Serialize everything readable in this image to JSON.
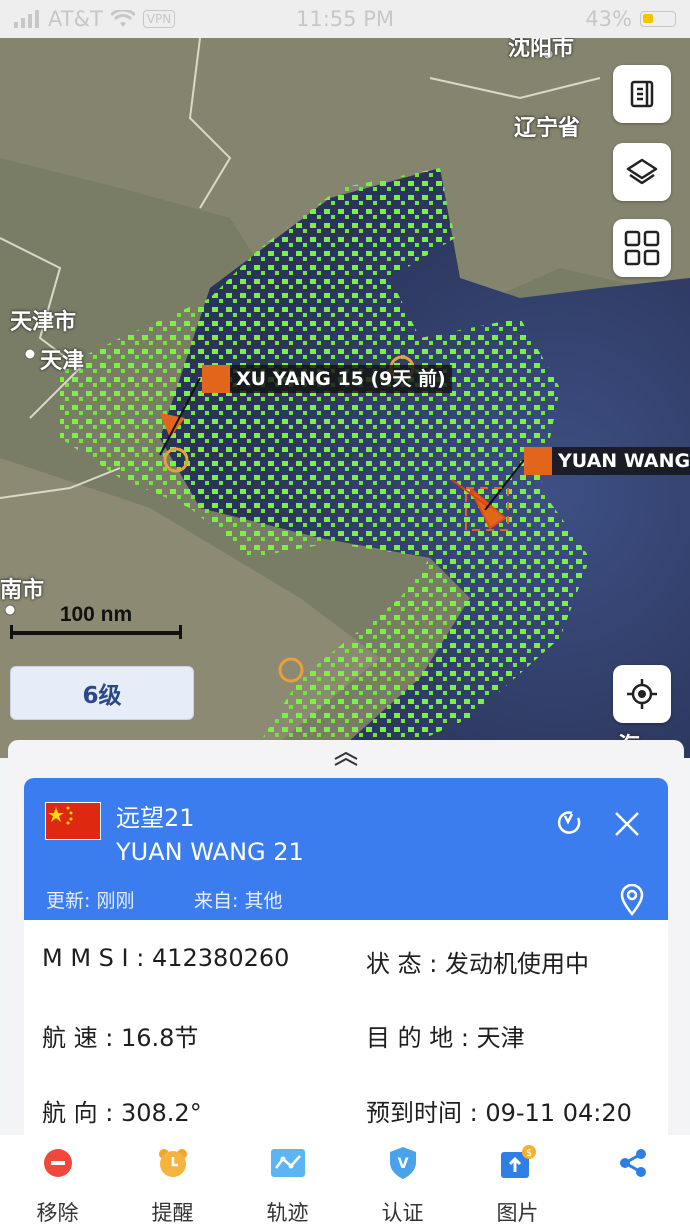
{
  "status_bar": {
    "carrier": "AT&T",
    "vpn": "VPN",
    "time": "11:55 PM",
    "battery": "43%",
    "battery_color": "#f5c400"
  },
  "map": {
    "place_labels": [
      "天津市",
      "天津",
      "辽宁省",
      "南市",
      "海",
      "沈阳市"
    ],
    "ships": [
      {
        "label": "XU YANG 15 (9天  前)",
        "color": "#e2661a"
      },
      {
        "label": "YUAN WANG",
        "color": "#e2661a"
      }
    ],
    "scale_label": "100 nm",
    "zoom_level": "6级",
    "controls": [
      "document-icon",
      "layers-icon",
      "grid-icon",
      "locate-icon"
    ]
  },
  "vessel": {
    "name_cn": "远望21",
    "name_en": "YUAN WANG 21",
    "updated": "更新:  刚刚",
    "source": "来自:  其他",
    "header_color": "#3b7dee",
    "fields": {
      "mmsi_label": "M  M  S  I : ",
      "mmsi": "412380260",
      "status_label": "状       态 : ",
      "status": "发动机使用中",
      "speed_label": "航       速 : ",
      "speed": "16.8节",
      "dest_label": "目   的   地 : ",
      "dest": "天津",
      "heading_label": "航       向 : ",
      "heading": "308.2°",
      "eta_label": "预到时间 : ",
      "eta": "09-11 04:20"
    }
  },
  "tabbar": {
    "items": [
      {
        "label": "移除",
        "icon": "remove-icon"
      },
      {
        "label": "提醒",
        "icon": "alarm-clock-icon"
      },
      {
        "label": "轨迹",
        "icon": "track-icon"
      },
      {
        "label": "认证",
        "icon": "verify-shield-icon"
      },
      {
        "label": "图片",
        "icon": "photo-upload-icon"
      },
      {
        "label": "",
        "icon": "share-icon"
      }
    ]
  }
}
